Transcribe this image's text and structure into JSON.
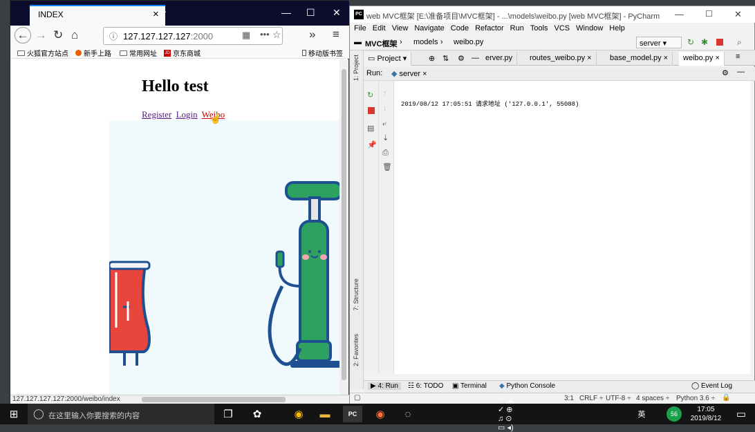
{
  "firefox": {
    "tab_title": "INDEX",
    "url_host": "127.127.127.127",
    "url_port": ":2000",
    "bookmarks": [
      "火狐官方站点",
      "新手上路",
      "常用网址",
      "京东商城"
    ],
    "mobile_bookmarks": "移动版书签",
    "page": {
      "heading": "Hello test",
      "links": [
        "Register",
        "Login",
        "Weibo"
      ]
    },
    "status_url": "127.127.127.127:2000/weibo/index"
  },
  "pycharm": {
    "title": "web MVC框架 [E:\\准备项目\\MVC框架] - ...\\models\\weibo.py [web MVC框架] - PyCharm",
    "menu": [
      "File",
      "Edit",
      "View",
      "Navigate",
      "Code",
      "Refactor",
      "Run",
      "Tools",
      "VCS",
      "Window",
      "Help"
    ],
    "breadcrumbs": [
      "MVC框架",
      "models",
      "weibo.py"
    ],
    "run_config": "server",
    "editor_tabs": [
      "erver.py",
      "routes_weibo.py",
      "base_model.py",
      "weibo.py"
    ],
    "run": {
      "label": "Run:",
      "config_tab": "server",
      "console_lines": [
        "",
        "2019/08/12 17:05:51 请求地址 ('127.0.0.1', 55088)"
      ]
    },
    "side_labels": {
      "project": "1: Project",
      "structure": "7: Structure",
      "favorites": "2: Favorites"
    },
    "tool_tabs": [
      "4: Run",
      "6: TODO",
      "Terminal",
      "Python Console"
    ],
    "event_log": "Event Log",
    "status": {
      "pos": "3:1",
      "line_sep": "CRLF ÷",
      "encoding": "UTF-8 ÷",
      "indent": "4 spaces ÷",
      "interp": "Python 3.6 ÷"
    }
  },
  "taskbar": {
    "search_placeholder": "在这里输入你要搜索的内容",
    "ime": "英",
    "time": "17:05",
    "date": "2019/8/12"
  },
  "colors": {
    "ff_tabbar": "#0c0c2d",
    "ff_accent": "#0a84ff",
    "illus_bg": "#f0fafc",
    "pump_green": "#2ea05f",
    "can_red": "#e8453c",
    "outline_blue": "#1d4f91"
  }
}
